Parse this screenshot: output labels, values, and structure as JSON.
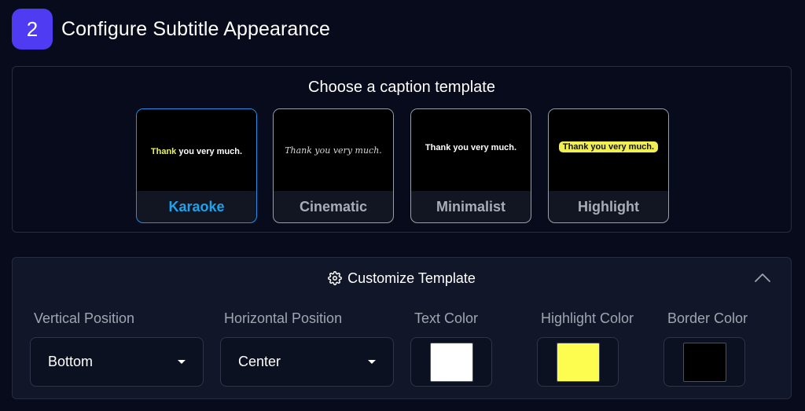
{
  "step": {
    "number": "2",
    "title": "Configure Subtitle Appearance"
  },
  "templates": {
    "heading": "Choose a caption template",
    "selected": "Karaoke",
    "items": [
      {
        "label": "Karaoke",
        "preview_highlight": "Thank",
        "preview_rest": " you very much."
      },
      {
        "label": "Cinematic",
        "preview": "Thank you very much."
      },
      {
        "label": "Minimalist",
        "preview": "Thank you very much."
      },
      {
        "label": "Highlight",
        "preview": "Thank you very much."
      }
    ]
  },
  "customize": {
    "title": "Customize Template",
    "icon": "gear-icon",
    "collapse_icon": "chevron-up-icon",
    "vertical_position": {
      "label": "Vertical Position",
      "value": "Bottom"
    },
    "horizontal_position": {
      "label": "Horizontal Position",
      "value": "Center"
    },
    "text_color": {
      "label": "Text Color",
      "value": "#ffffff"
    },
    "highlight_color": {
      "label": "Highlight Color",
      "value": "#fdfd4f"
    },
    "border_color": {
      "label": "Border Color",
      "value": "#000000"
    }
  },
  "colors": {
    "accent": "#4f3cf2",
    "selected": "#1aa4ee",
    "background": "#070b1b"
  }
}
